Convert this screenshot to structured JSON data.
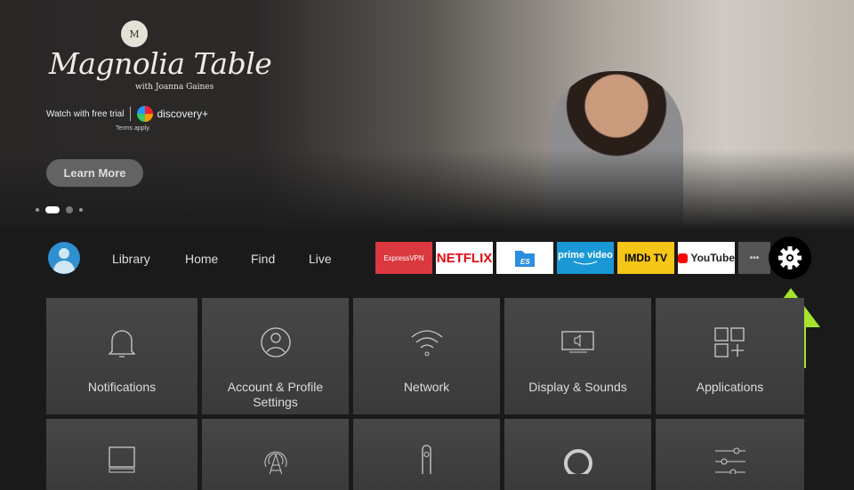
{
  "hero": {
    "badge": "M",
    "title": "Magnolia Table",
    "subtitle": "with Joanna Gaines",
    "trial_text": "Watch with free trial",
    "partner": "discovery+",
    "terms": "Terms apply.",
    "button": "Learn More",
    "carousel_active_index": 1,
    "carousel_count": 4
  },
  "nav": {
    "links": [
      "Library",
      "Home",
      "Find",
      "Live"
    ]
  },
  "apps": [
    {
      "label": "ExpressVPN",
      "bg": "#da3940",
      "color": "#ffffff"
    },
    {
      "label": "NETFLIX",
      "bg": "#ffffff",
      "color": "#e50914"
    },
    {
      "label": "ES File Explorer",
      "bg": "#ffffff",
      "color": "#2b8ee0"
    },
    {
      "label": "prime video",
      "bg": "#1a98d5",
      "color": "#ffffff"
    },
    {
      "label": "IMDb TV",
      "bg": "#f5c518",
      "color": "#000000"
    },
    {
      "label": "YouTube",
      "bg": "#ffffff",
      "color": "#222222"
    },
    {
      "label": "•••",
      "bg": "#555555",
      "color": "#cccccc"
    }
  ],
  "settings_tiles": [
    {
      "label": "Notifications",
      "icon": "bell-icon"
    },
    {
      "label": "Account & Profile Settings",
      "icon": "account-icon"
    },
    {
      "label": "Network",
      "icon": "wifi-icon"
    },
    {
      "label": "Display & Sounds",
      "icon": "tv-sound-icon"
    },
    {
      "label": "Applications",
      "icon": "apps-icon"
    },
    {
      "label": "",
      "icon": "device-icon"
    },
    {
      "label": "",
      "icon": "antenna-icon"
    },
    {
      "label": "",
      "icon": "remote-icon"
    },
    {
      "label": "",
      "icon": "alexa-icon"
    },
    {
      "label": "",
      "icon": "sliders-icon"
    }
  ],
  "colors": {
    "highlight_arrow": "#a6e22e",
    "accent": "#2f8fd0"
  }
}
